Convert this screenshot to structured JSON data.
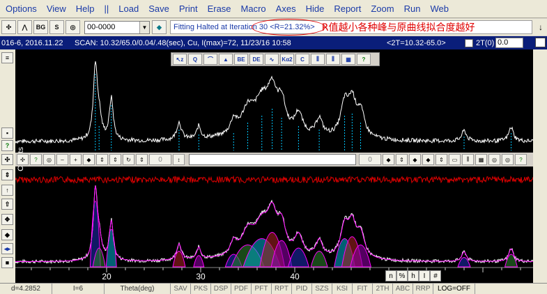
{
  "menu": [
    "Options",
    "View",
    "Help",
    "||",
    "Load",
    "Save",
    "Print",
    "Erase",
    "Macro",
    "Axes",
    "Hide",
    "Report",
    "Zoom",
    "Run",
    "Web"
  ],
  "toolbar": {
    "combo_value": "00-0000",
    "status_text": "Fitting Halted at Iteration 30 <R=21.32%>",
    "annotation": "R值越小各种峰与原曲线拟合度越好"
  },
  "scanbar": {
    "date": "016-6, 2016.11.22",
    "scan": "SCAN: 10.32/65.0/0.04/.48(sec), Cu, I(max)=72, 11/23/16 10:58",
    "range": "<2T=10.32-65.0>",
    "twotheta_label": "2T(0)",
    "twotheta_value": "0.0"
  },
  "plot": {
    "y_label": "Counts",
    "x_ticks": [
      "20",
      "30",
      "40"
    ],
    "mid_field_a": "0",
    "mid_field_b": "0"
  },
  "axis_widget": [
    "n",
    "%",
    "h",
    "I",
    "#"
  ],
  "statusbar": {
    "d_value": "d=4.2852",
    "i_value": "I=6",
    "theta": "Theta(deg)",
    "buttons": [
      "SAV",
      "PKS",
      "DSP",
      "PDF",
      "PFT",
      "RPT",
      "PID",
      "SZS",
      "KSI",
      "FIT",
      "2TH",
      "ABC",
      "RRP"
    ],
    "log": "LOG=OFF"
  },
  "colors": {
    "pattern": "#ffffff",
    "residual": "#e00000",
    "fit_peaks": "#ff00ff",
    "peak_markers": "#00c8ff",
    "plot_background": "#000000",
    "title_bar": "#0a1e7a"
  }
}
